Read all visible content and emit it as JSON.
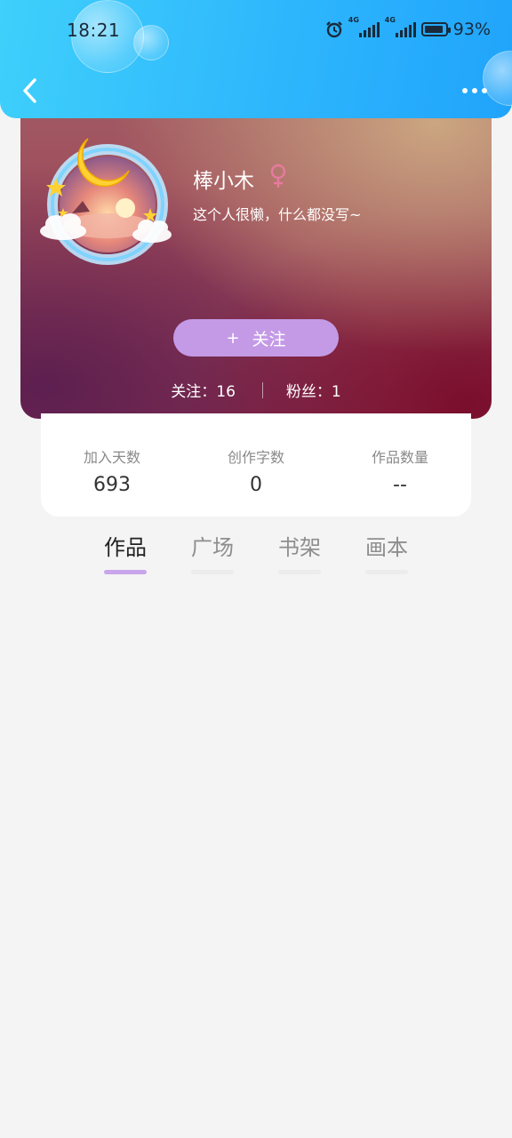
{
  "status_bar": {
    "time": "18:21",
    "signal_1_label": "4G",
    "signal_2_label": "4G",
    "battery_text": "93%",
    "battery_level": 0.93,
    "icons": [
      "alarm-icon",
      "signal-icon",
      "signal-icon",
      "battery-icon"
    ]
  },
  "nav": {
    "back_icon": "chevron-left-icon",
    "more_icon": "more-dots-icon"
  },
  "profile": {
    "username": "棒小木",
    "gender_icon": "female-icon",
    "bio": "这个人很懒，什么都没写~",
    "follow_button": "关注",
    "follow_icon": "+",
    "following_label": "关注：16",
    "fans_label": "粉丝：1",
    "colors": {
      "follow_button": "#c49ae6",
      "gender": "#e87aa0",
      "header": "#2eb6fc"
    }
  },
  "stats": {
    "join_days_label": "加入天数",
    "join_days_value": "693",
    "words_label": "创作字数",
    "words_value": "0",
    "works_label": "作品数量",
    "works_value": "--"
  },
  "tabs": [
    {
      "label": "作品",
      "active": true
    },
    {
      "label": "广场",
      "active": false
    },
    {
      "label": "书架",
      "active": false
    },
    {
      "label": "画本",
      "active": false
    }
  ]
}
